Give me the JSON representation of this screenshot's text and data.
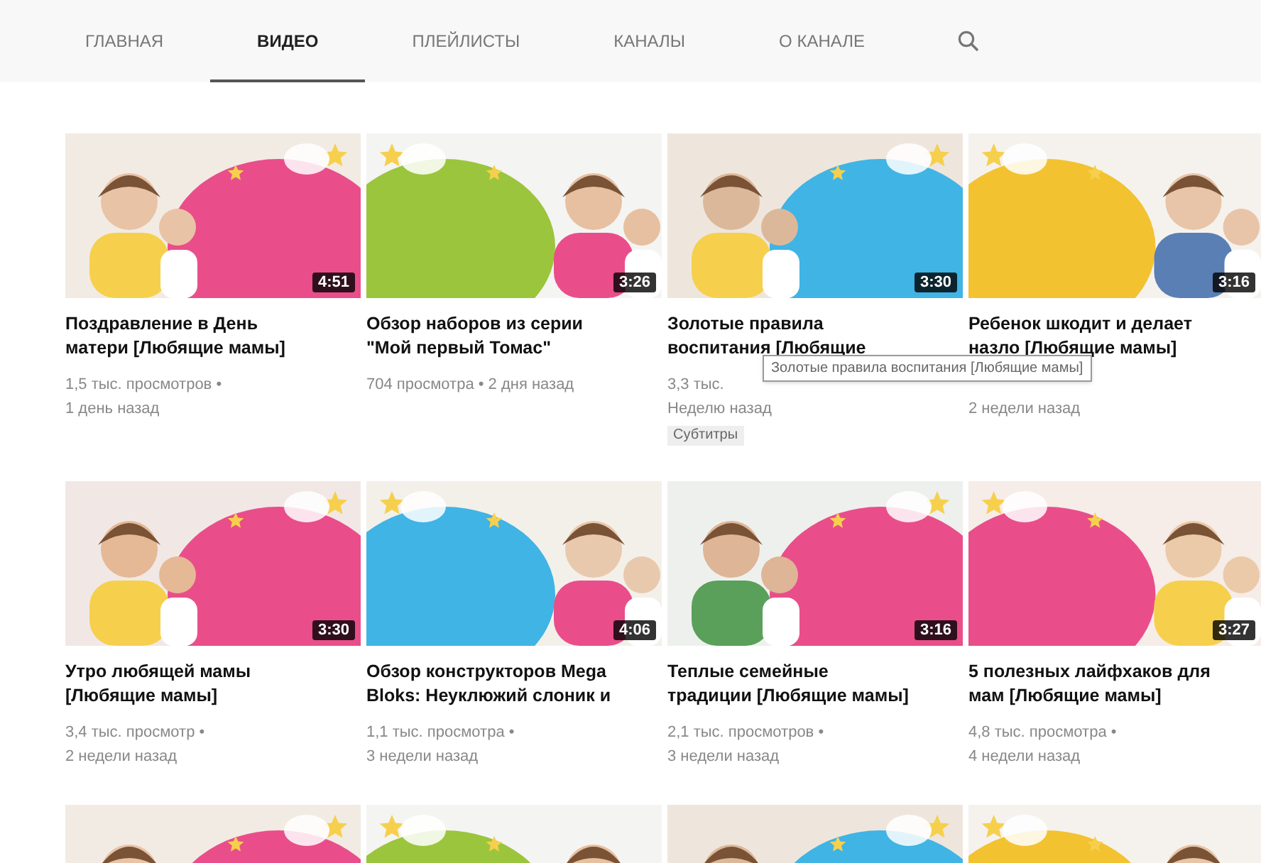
{
  "tabs": [
    {
      "label": "ГЛАВНАЯ",
      "selected": false
    },
    {
      "label": "ВИДЕО",
      "selected": true
    },
    {
      "label": "ПЛЕЙЛИСТЫ",
      "selected": false
    },
    {
      "label": "КАНАЛЫ",
      "selected": false
    },
    {
      "label": "О КАНАЛЕ",
      "selected": false
    }
  ],
  "videos": [
    {
      "thumbnail": {
        "kind": "picture"
      },
      "duration": "4:51",
      "title": "Поздравление в День матери [Любящие мамы]",
      "views": "1,5 тыс. просмотров •",
      "age": "1 день назад"
    },
    {
      "thumbnail": {
        "kind": "picture"
      },
      "duration": "3:26",
      "title": "Обзор наборов из серии \"Мой первый Томас\"",
      "views": "704 просмотра • 2 дня назад"
    },
    {
      "thumbnail": {
        "kind": "picture"
      },
      "duration": "3:30",
      "title": "Золотые правила воспитания [Любящие",
      "views": "3,3 тыс.",
      "age": "Неделю назад",
      "badge": "Субтитры"
    },
    {
      "thumbnail": {
        "kind": "picture"
      },
      "duration": "3:16",
      "title": "Ребенок шкодит и делает назло [Любящие мамы]",
      "age": "2 недели назад"
    },
    {
      "thumbnail": {
        "kind": "picture"
      },
      "duration": "3:30",
      "title": "Утро любящей мамы [Любящие мамы]",
      "views": "3,4 тыс. просмотр •",
      "age": "2 недели назад"
    },
    {
      "thumbnail": {
        "kind": "picture"
      },
      "duration": "4:06",
      "title": "Обзор конструкторов Mega Bloks: Неуклюжий слоник и",
      "views": "1,1 тыс. просмотра •",
      "age": "3 недели назад"
    },
    {
      "thumbnail": {
        "kind": "picture"
      },
      "duration": "3:16",
      "title": "Теплые семейные традиции [Любящие мамы]",
      "views": "2,1 тыс. просмотров •",
      "age": "3 недели назад"
    },
    {
      "thumbnail": {
        "kind": "picture"
      },
      "duration": "3:27",
      "title": "5 полезных лайфхаков для мам [Любящие мамы]",
      "views": "4,8 тыс. просмотра •",
      "age": "4 недели назад"
    },
    {
      "thumbnail": {
        "kind": "picture"
      }
    },
    {
      "thumbnail": {
        "kind": "picture"
      }
    },
    {
      "thumbnail": {
        "kind": "picture"
      }
    },
    {
      "thumbnail": {
        "kind": "picture"
      }
    }
  ],
  "tooltip": "Золотые правила воспитания [Любящие мамы]"
}
